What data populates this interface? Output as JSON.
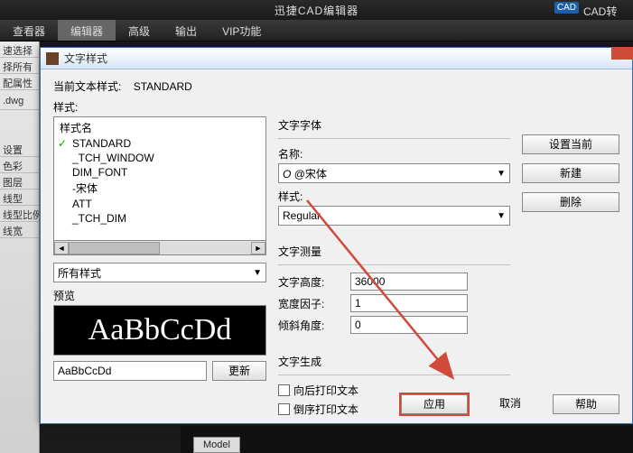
{
  "app": {
    "title": "迅捷CAD编辑器",
    "badge": "CAD",
    "badge_text": "CAD转"
  },
  "ribbon": {
    "tabs": [
      "查看器",
      "编辑器",
      "高级",
      "输出",
      "VIP功能"
    ],
    "active": 1
  },
  "left_panel": {
    "items1": [
      "速选择",
      "择所有",
      "配属性"
    ],
    "file": ".dwg",
    "items2": [
      "设置",
      "色彩",
      "图层",
      "线型",
      "线型比例",
      "线宽"
    ]
  },
  "dialog": {
    "title": "文字样式",
    "current_label": "当前文本样式:",
    "current_value": "STANDARD",
    "styles_label": "样式:",
    "stylename_header": "样式名",
    "style_items": [
      "STANDARD",
      "_TCH_WINDOW",
      "DIM_FONT",
      "-宋体",
      "ATT",
      "_TCH_DIM"
    ],
    "filter_label": "所有样式",
    "preview_label": "预览",
    "preview_display": "AaBbCcDd",
    "preview_value": "AaBbCcDd",
    "update_btn": "更新",
    "font_group": "文字字体",
    "name_label": "名称:",
    "font_name": "@宋体",
    "style_label": "样式:",
    "font_style": "Regular",
    "measure_group": "文字测量",
    "height_label": "文字高度:",
    "height_value": "36000",
    "width_label": "宽度因子:",
    "width_value": "1",
    "oblique_label": "倾斜角度:",
    "oblique_value": "0",
    "gen_group": "文字生成",
    "backwards_label": "向后打印文本",
    "upside_label": "倒序打印文本",
    "btn_setcurrent": "设置当前",
    "btn_new": "新建",
    "btn_delete": "删除",
    "btn_apply": "应用",
    "btn_cancel": "取消",
    "btn_help": "帮助"
  },
  "bottom": {
    "model_tab": "Model"
  }
}
